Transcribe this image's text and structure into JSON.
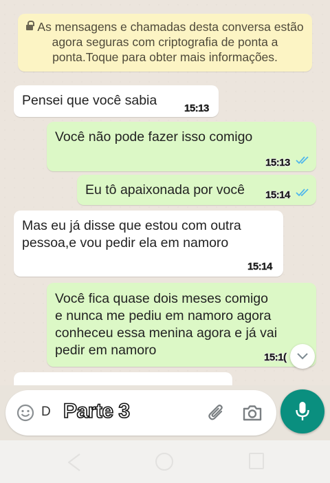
{
  "system_notice": "As mensagens e chamadas desta conversa estão agora seguras com criptografia de ponta a ponta.Toque para obter mais informações.",
  "messages": [
    {
      "direction": "in",
      "line1": "Pensei que você sabia",
      "time": "15:13"
    },
    {
      "direction": "out",
      "line1": "Você não pode fazer isso comigo",
      "time": "15:13",
      "status": "read"
    },
    {
      "direction": "out",
      "line1": "Eu tô apaixonada por você",
      "time": "15:14",
      "status": "read"
    },
    {
      "direction": "in",
      "line1": "Mas eu já disse que estou com outra",
      "line2": "pessoa,e vou pedir ela em namoro",
      "time": "15:14"
    },
    {
      "direction": "out",
      "line1": "Você fica quase dois meses comigo",
      "line2": "e nunca me pediu em namoro agora",
      "line3": "conheceu essa menina agora e já vai",
      "line4": "pedir em namoro",
      "time": "15:1("
    }
  ],
  "composer": {
    "draft_prefix": "D",
    "overlay_caption": "Parte 3"
  },
  "colors": {
    "incoming_bubble": "#ffffff",
    "outgoing_bubble": "#dcf8c6",
    "notice_bg": "#fcf4c4",
    "mic_button": "#0a8f7f",
    "read_ticks": "#4fb6ec"
  },
  "icons": [
    "lock-icon",
    "double-check-icon",
    "chevron-down-icon",
    "emoji-icon",
    "attach-icon",
    "camera-icon",
    "mic-icon",
    "nav-back-icon",
    "nav-home-icon",
    "nav-recent-icon"
  ]
}
